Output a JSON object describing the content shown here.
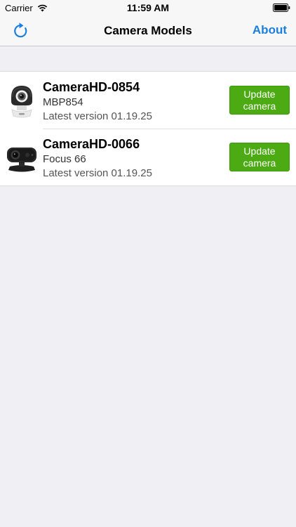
{
  "status_bar": {
    "carrier": "Carrier",
    "time": "11:59 AM"
  },
  "nav": {
    "title": "Camera Models",
    "about_label": "About",
    "accent_color": "#1b7fe0"
  },
  "cameras": [
    {
      "name": "CameraHD-0854",
      "model": "MBP854",
      "version": "Latest version 01.19.25",
      "button_label": "Update camera",
      "thumbnail": "dome-camera-icon"
    },
    {
      "name": "CameraHD-0066",
      "model": "Focus 66",
      "version": "Latest version 01.19.25",
      "button_label": "Update camera",
      "thumbnail": "wide-camera-icon"
    }
  ],
  "colors": {
    "button_green": "#4caa12",
    "background": "#efeff4"
  }
}
